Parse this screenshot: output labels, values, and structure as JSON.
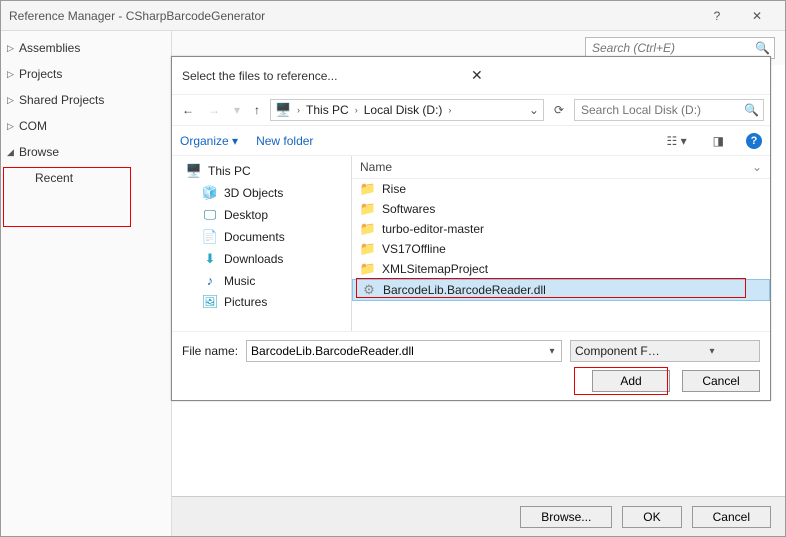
{
  "window": {
    "title": "Reference Manager - CSharpBarcodeGenerator",
    "search_placeholder": "Search (Ctrl+E)",
    "buttons": {
      "browse": "Browse...",
      "ok": "OK",
      "cancel": "Cancel"
    }
  },
  "sidebar": {
    "items": [
      "Assemblies",
      "Projects",
      "Shared Projects",
      "COM",
      "Browse"
    ],
    "recent": "Recent"
  },
  "dialog": {
    "title": "Select the files to reference...",
    "breadcrumb": {
      "thispc": "This PC",
      "drive": "Local Disk (D:)"
    },
    "search_placeholder": "Search Local Disk (D:)",
    "organize": "Organize",
    "newfolder": "New folder",
    "tree": {
      "thispc": "This PC",
      "items": [
        "3D Objects",
        "Desktop",
        "Documents",
        "Downloads",
        "Music",
        "Pictures"
      ]
    },
    "list": {
      "name_col": "Name",
      "files": [
        {
          "label": "Rise",
          "type": "folder"
        },
        {
          "label": "Softwares",
          "type": "folder"
        },
        {
          "label": "turbo-editor-master",
          "type": "folder"
        },
        {
          "label": "VS17Offline",
          "type": "folder"
        },
        {
          "label": "XMLSitemapProject",
          "type": "folder"
        },
        {
          "label": "BarcodeLib.BarcodeReader.dll",
          "type": "dll",
          "selected": true
        }
      ]
    },
    "filename_label": "File name:",
    "filename_value": "BarcodeLib.BarcodeReader.dll",
    "filter": "Component Files (*.dll;*.tlb;*.ol",
    "add": "Add",
    "cancel": "Cancel"
  }
}
